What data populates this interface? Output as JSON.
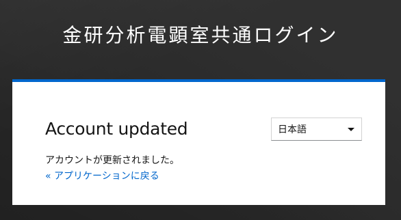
{
  "header": {
    "title": "金研分析電顕室共通ログイン"
  },
  "card": {
    "heading": "Account updated",
    "message": "アカウントが更新されました。",
    "back_link": "« アプリケーションに戻る"
  },
  "language_selector": {
    "selected": "日本語",
    "icon": "caret-down-icon"
  },
  "colors": {
    "background": "#2c2c2c",
    "card_accent": "#0066cc",
    "link": "#0066cc"
  }
}
